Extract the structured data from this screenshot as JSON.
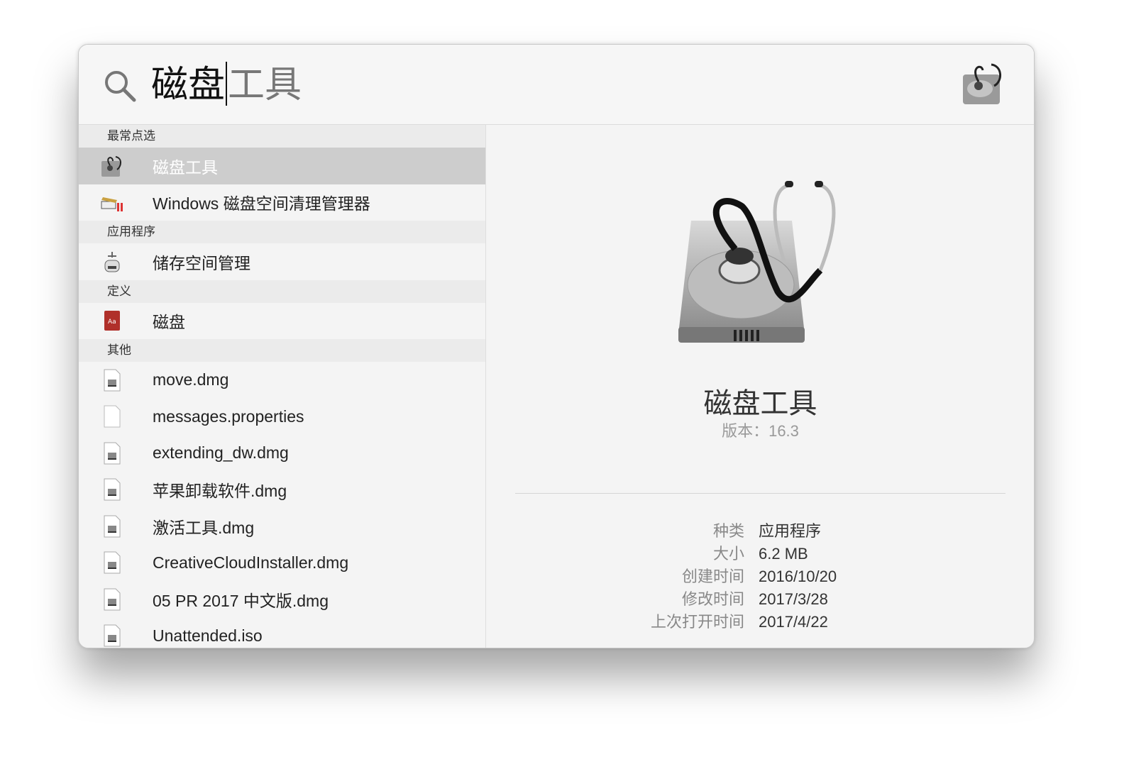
{
  "search": {
    "typed": "磁盘",
    "completion": "工具",
    "icon": "magnifier-icon"
  },
  "sections": [
    {
      "title": "最常点选",
      "items": [
        {
          "label": "磁盘工具",
          "icon": "disk-utility-icon",
          "selected": true
        },
        {
          "label": "Windows 磁盘空间清理管理器",
          "icon": "cleaner-app-icon"
        }
      ]
    },
    {
      "title": "应用程序",
      "items": [
        {
          "label": "储存空间管理",
          "icon": "storage-management-icon"
        }
      ]
    },
    {
      "title": "定义",
      "items": [
        {
          "label": "磁盘",
          "icon": "dictionary-icon"
        }
      ]
    },
    {
      "title": "其他",
      "items": [
        {
          "label": "move.dmg",
          "icon": "dmg-file-icon"
        },
        {
          "label": "messages.properties",
          "icon": "blank-file-icon"
        },
        {
          "label": "extending_dw.dmg",
          "icon": "dmg-file-icon"
        },
        {
          "label": "苹果卸载软件.dmg",
          "icon": "dmg-file-icon"
        },
        {
          "label": "激活工具.dmg",
          "icon": "dmg-file-icon"
        },
        {
          "label": "CreativeCloudInstaller.dmg",
          "icon": "dmg-file-icon"
        },
        {
          "label": "05 PR 2017 中文版.dmg",
          "icon": "dmg-file-icon"
        },
        {
          "label": "Unattended.iso",
          "icon": "dmg-file-icon"
        }
      ]
    }
  ],
  "preview": {
    "title": "磁盘工具",
    "version": "版本：16.3",
    "meta": [
      {
        "k": "种类",
        "v": "应用程序"
      },
      {
        "k": "大小",
        "v": "6.2 MB"
      },
      {
        "k": "创建时间",
        "v": "2016/10/20"
      },
      {
        "k": "修改时间",
        "v": "2017/3/28"
      },
      {
        "k": "上次打开时间",
        "v": "2017/4/22"
      }
    ]
  }
}
